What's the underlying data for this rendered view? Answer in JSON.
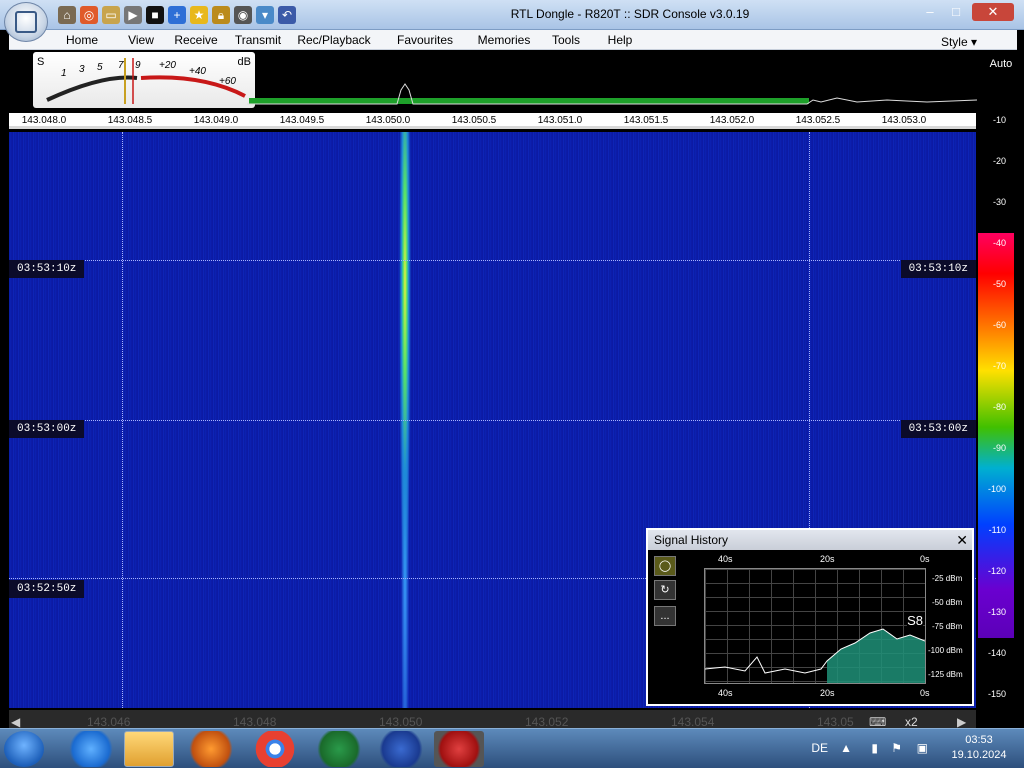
{
  "window": {
    "title": "RTL Dongle - R820T :: SDR Console v3.0.19"
  },
  "menu": {
    "items": [
      "Home",
      "View",
      "Receive",
      "Transmit",
      "Rec/Playback",
      "Favourites",
      "Memories",
      "Tools",
      "Help"
    ],
    "style": "Style"
  },
  "smeter": {
    "s": "S",
    "db": "dB",
    "ticks": [
      "1",
      "3",
      "5",
      "7",
      "9",
      "+20",
      "+40",
      "+60"
    ]
  },
  "freq_axis": [
    "143.048.0",
    "143.048.5",
    "143.049.0",
    "143.049.5",
    "143.050.0",
    "143.050.5",
    "143.051.0",
    "143.051.5",
    "143.052.0",
    "143.052.5",
    "143.053.0"
  ],
  "waterfall": {
    "times": [
      "03:53:10z",
      "03:53:00z",
      "03:52:50z"
    ]
  },
  "scale": {
    "auto": "Auto",
    "ticks": [
      "-10",
      "-20",
      "-30",
      "-40",
      "-50",
      "-60",
      "-70",
      "-80",
      "-90",
      "-100",
      "-110",
      "-120",
      "-130",
      "-140",
      "-150"
    ]
  },
  "signal_history": {
    "title": "Signal History",
    "top_axis": [
      "40s",
      "20s",
      "0s"
    ],
    "bottom_axis": [
      "40s",
      "20s",
      "0s"
    ],
    "y_labels": [
      "-25 dBm",
      "-50 dBm",
      "-75 dBm",
      "-100 dBm",
      "-125 dBm"
    ],
    "s_value": "S8",
    "menu_dots": "..."
  },
  "bottom_scale": {
    "labels": [
      "143.046",
      "143.048",
      "143.050",
      "143.052",
      "143.054",
      "143.05"
    ],
    "zoom": "x2"
  },
  "taskbar": {
    "lang": "DE",
    "time": "03:53",
    "date": "19.10.2024"
  },
  "colors": {
    "accent": "#0a1aa4",
    "signal": "#54e06a"
  }
}
